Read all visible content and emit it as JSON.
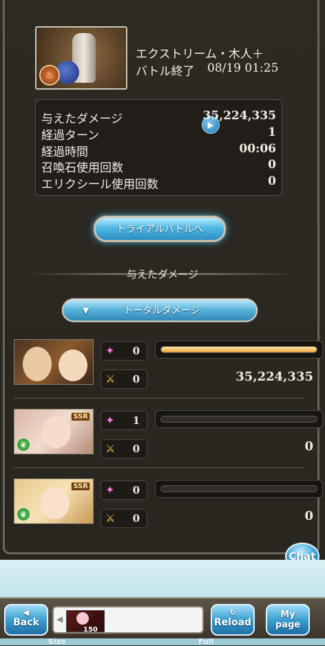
{
  "quest": {
    "title": "エクストリーム・木人＋",
    "status": "バトル終了",
    "datetime": "08/19 01:25",
    "element_icon": "fire-element-icon"
  },
  "stats": [
    {
      "label": "与えたダメージ",
      "value": "35,224,335"
    },
    {
      "label": "経過ターン",
      "value": "1"
    },
    {
      "label": "経過時間",
      "value": "00:06"
    },
    {
      "label": "召喚石使用回数",
      "value": "0"
    },
    {
      "label": "エリクシール使用回数",
      "value": "0"
    }
  ],
  "trial_button": "トライアルバトルへ",
  "damage_section": {
    "title": "与えたダメージ",
    "total_button": "トータルダメージ"
  },
  "characters": [
    {
      "skills": "0",
      "ougi": "0",
      "damage": "35,224,335",
      "damage_share": 1.0,
      "rarity": ""
    },
    {
      "skills": "1",
      "ougi": "0",
      "damage": "0",
      "damage_share": 0.0,
      "rarity": "SSR"
    },
    {
      "skills": "0",
      "ougi": "0",
      "damage": "0",
      "damage_share": 0.0,
      "rarity": "SSR"
    }
  ],
  "chat": "Chat",
  "footer": {
    "back": "Back",
    "reload": "Reload",
    "mypage": "My page",
    "quick_count": "150",
    "size_label": "Size",
    "full_label": "Full"
  },
  "colors": {
    "accent_blue": "#4fb8e3",
    "damage_bar": "#e6a441",
    "panel_bg": "#2a2620"
  }
}
